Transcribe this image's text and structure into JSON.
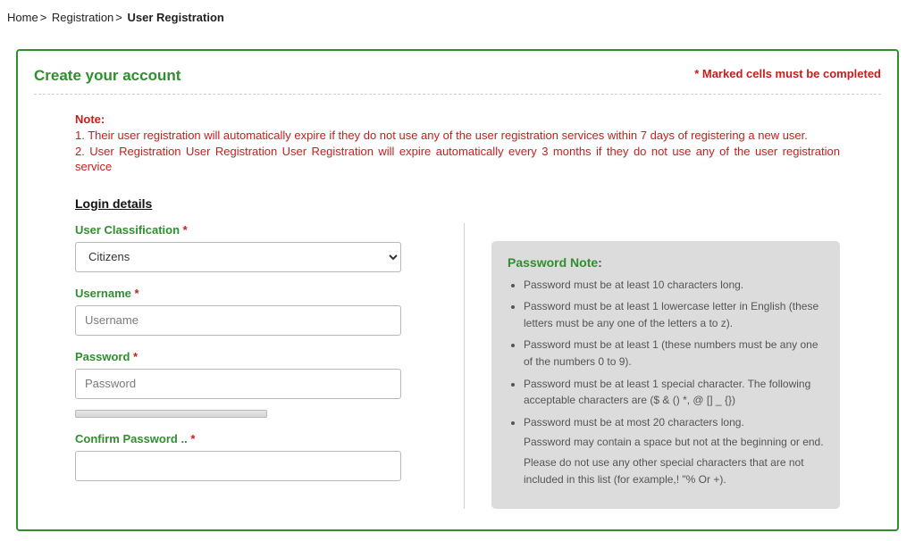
{
  "breadcrumb": {
    "home": "Home",
    "step1": "Registration",
    "current": "User Registration"
  },
  "panel": {
    "title": "Create your account",
    "required_note": "* Marked cells must be completed"
  },
  "note": {
    "heading": "Note:",
    "line1": "1. Their user registration will automatically expire if they do not use any of the user registration services within 7 days of registering a new user.",
    "line2": "2. User Registration User Registration User Registration will expire automatically every 3 months if they do not use any of the user registration service"
  },
  "login_details": {
    "heading": "Login details",
    "classification": {
      "label": "User Classification",
      "selected": "Citizens"
    },
    "username": {
      "label": "Username",
      "placeholder": "Username",
      "value": ""
    },
    "password": {
      "label": "Password",
      "placeholder": "Password",
      "value": ""
    },
    "confirm_password": {
      "label": "Confirm Password ..",
      "value": ""
    }
  },
  "password_note": {
    "title": "Password Note",
    "items": [
      "Password must be at least 10 characters long.",
      "Password must be at least 1 lowercase letter in English (these letters must be any one of the letters a to z).",
      "Password must be at least 1 (these numbers must be any one of the numbers 0 to 9).",
      "Password must be at least 1 special character. The following acceptable characters are ($ & () *, @ [] _ {})",
      "Password must be at most 20 characters long."
    ],
    "extra1": "Password may contain a space but not at the beginning or end.",
    "extra2": "Please do not use any other special characters that are not included in this list (for example,! \"% Or +)."
  }
}
